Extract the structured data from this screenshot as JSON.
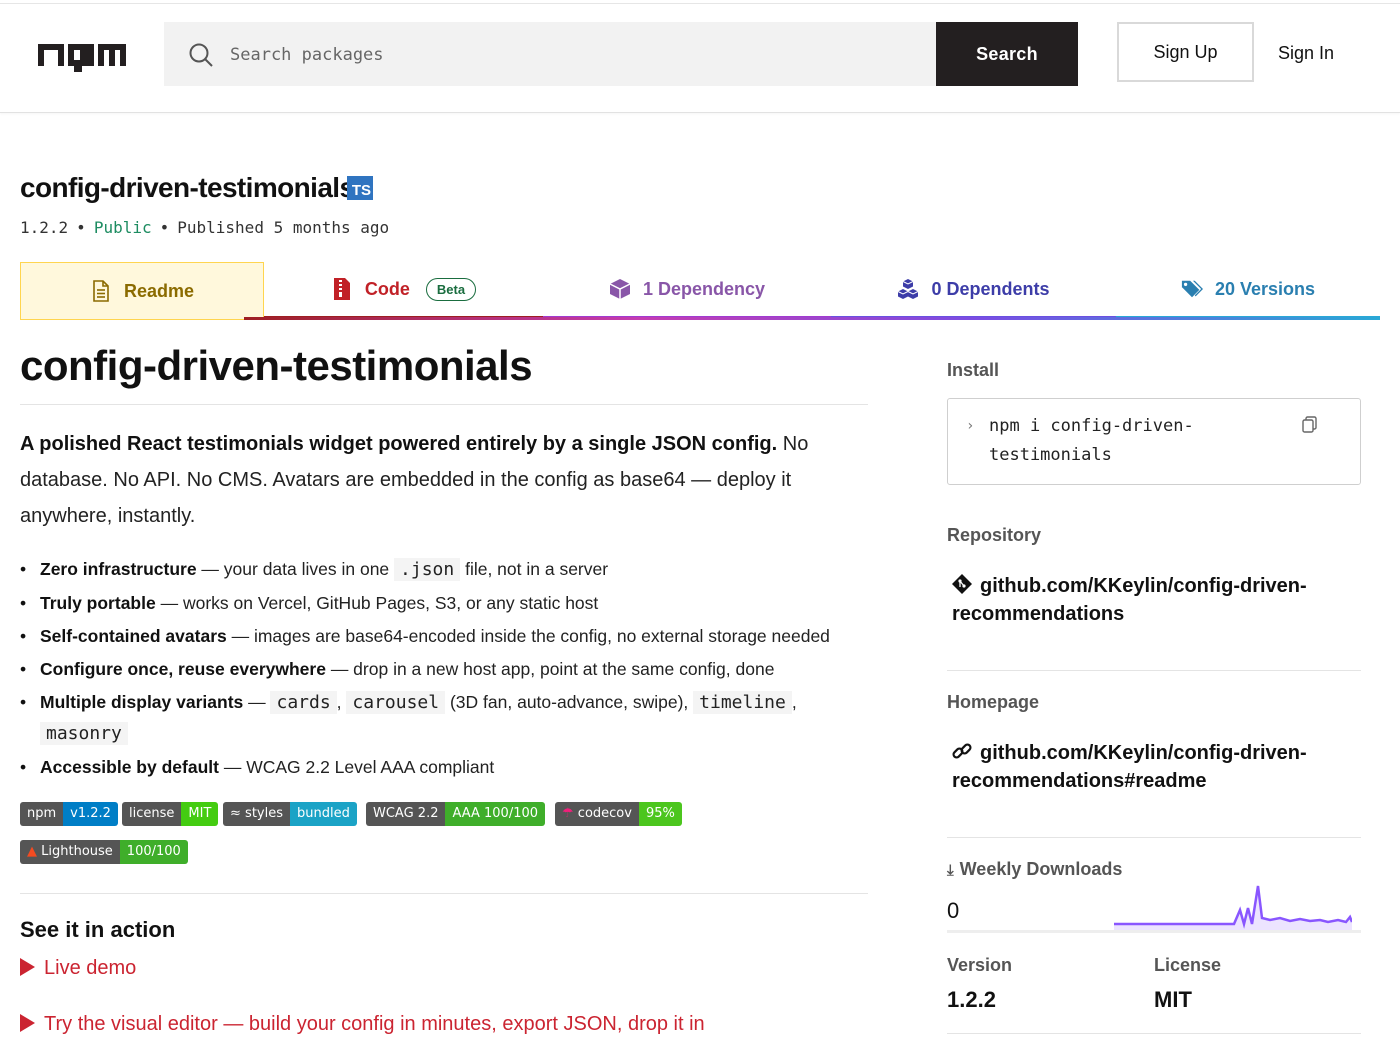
{
  "header": {
    "search_placeholder": "Search packages",
    "search_button": "Search",
    "signup": "Sign Up",
    "signin": "Sign In"
  },
  "package": {
    "name": "config-driven-testimonials",
    "types_badge": "TS",
    "version": "1.2.2",
    "visibility": "Public",
    "published": "Published 5 months ago"
  },
  "tabs": {
    "readme": "Readme",
    "code": "Code",
    "code_badge": "Beta",
    "dependencies": "1 Dependency",
    "dependents": "0 Dependents",
    "versions": "20 Versions"
  },
  "readme": {
    "title": "config-driven-testimonials",
    "intro_bold": "A polished React testimonials widget powered entirely by a single JSON config.",
    "intro_rest": " No database. No API. No CMS. Avatars are embedded in the config as base64 — deploy it anywhere, instantly.",
    "bullets": [
      {
        "bold": "Zero infrastructure",
        "pre": " — your data lives in one ",
        "code": ".json",
        "post": " file, not in a server"
      },
      {
        "bold": "Truly portable",
        "text": " — works on Vercel, GitHub Pages, S3, or any static host"
      },
      {
        "bold": "Self-contained avatars",
        "text": " — images are base64-encoded inside the config, no external storage needed"
      },
      {
        "bold": "Configure once, reuse everywhere",
        "text": " — drop in a new host app, point at the same config, done"
      },
      {
        "bold": "Multiple display variants",
        "dash": " — ",
        "c1": "cards",
        "sep1": ", ",
        "c2": "carousel",
        "mid": " (3D fan, auto-advance, swipe), ",
        "c3": "timeline",
        "sep2": ",",
        "c4": "masonry"
      },
      {
        "bold": "Accessible by default",
        "text": " — WCAG 2.2 Level AAA compliant"
      }
    ],
    "badges": [
      {
        "left": "npm",
        "right": "v1.2.2",
        "color": "#007ec6"
      },
      {
        "left": "license",
        "right": "MIT",
        "color": "#4c1"
      },
      {
        "left": "styles",
        "right": "bundled",
        "color": "#1ba3c6"
      },
      {
        "left": "WCAG 2.2",
        "right": "AAA 100/100",
        "color": "#3fae2a"
      },
      {
        "left": "codecov",
        "right": "95%",
        "color": "#4cc61e"
      },
      {
        "left": "Lighthouse",
        "right": "100/100",
        "color": "#3fae2a"
      }
    ],
    "see_heading": "See it in action",
    "demo_link": "Live demo",
    "editor_link": "Try the visual editor — build your config in minutes, export JSON, drop it in"
  },
  "sidebar": {
    "install_label": "Install",
    "install_cmd_line1": "npm i config-driven-",
    "install_cmd_line2": "testimonials",
    "repository_label": "Repository",
    "repository_line1": "github.com/KKeylin/config-driven-",
    "repository_line2": "recommendations",
    "homepage_label": "Homepage",
    "homepage_line1": "github.com/KKeylin/config-driven-",
    "homepage_line2": "recommendations#readme",
    "downloads_label": "Weekly Downloads",
    "downloads_count": "0",
    "version_label": "Version",
    "version_value": "1.2.2",
    "license_label": "License",
    "license_value": "MIT"
  },
  "colors": {
    "npm_red": "#cb2431",
    "readme_tab_bg": "#fff8dc",
    "sparkline": "#8956ff"
  }
}
